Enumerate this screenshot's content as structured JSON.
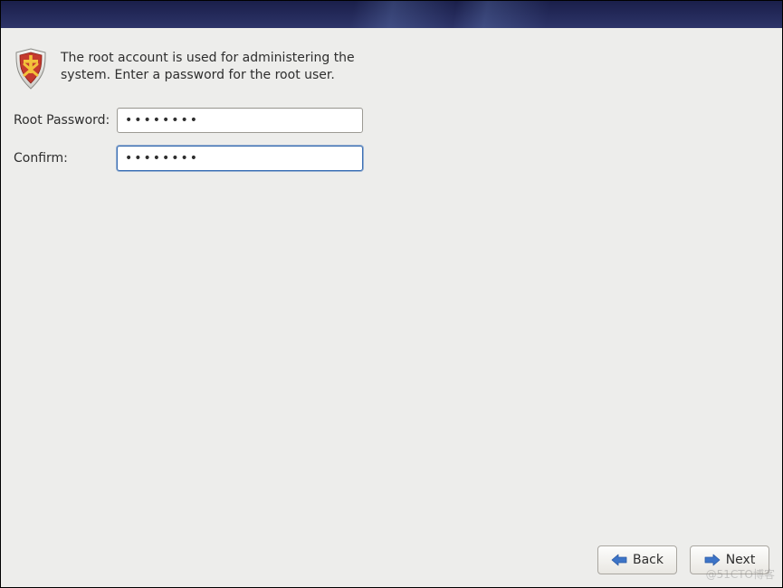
{
  "intro": {
    "text": "The root account is used for administering the system.  Enter a password for the root user."
  },
  "form": {
    "root_password": {
      "label": "Root Password:",
      "value": "••••••••"
    },
    "confirm": {
      "label": "Confirm:",
      "value": "••••••••"
    }
  },
  "footer": {
    "back_label": "Back",
    "next_label": "Next"
  },
  "watermark": "@51CTO博客"
}
